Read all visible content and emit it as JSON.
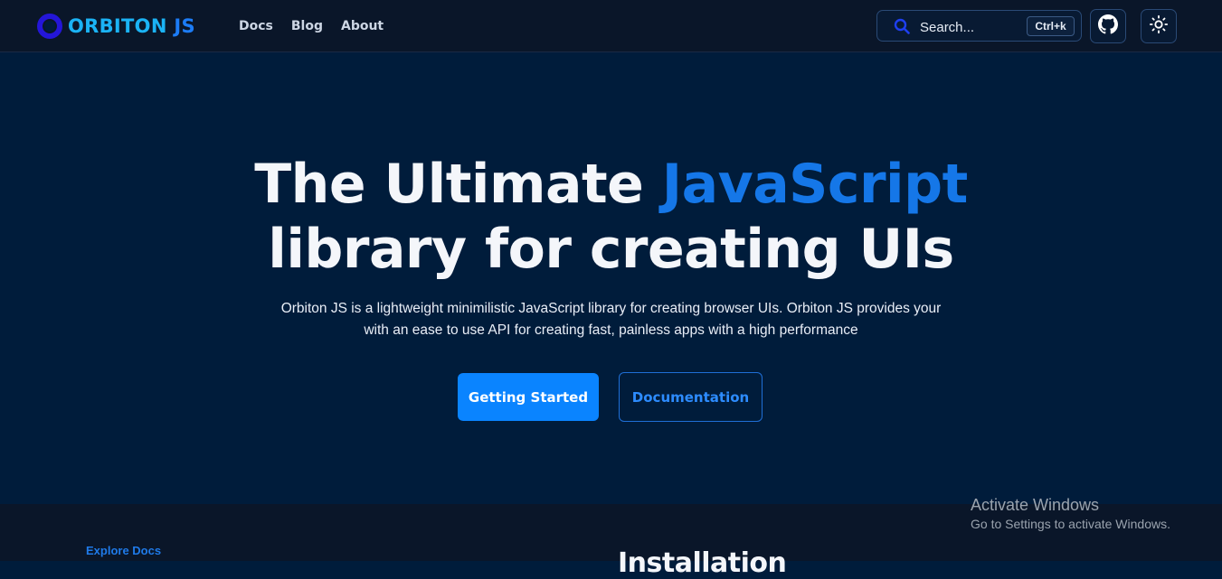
{
  "brand": {
    "name_main": "ORBITON",
    "name_suffix": "JS",
    "logo_icon": "orbit-ring-icon"
  },
  "nav": {
    "items": [
      {
        "label": "Docs"
      },
      {
        "label": "Blog"
      },
      {
        "label": "About"
      }
    ]
  },
  "search": {
    "placeholder": "Search...",
    "shortcut": "Ctrl+k",
    "icon": "search-icon"
  },
  "toolbar": {
    "github_icon": "github-icon",
    "theme_icon": "sun-icon"
  },
  "hero": {
    "title_part1": "The Ultimate ",
    "title_accent": "JavaScript",
    "title_part2": "library for creating UIs",
    "subtitle_line1": "Orbiton JS is a lightweight minimilistic JavaScript library for creating browser UIs. Orbiton JS provides your",
    "subtitle_line2": "with an ease to use API for creating fast, painless apps with a high performance",
    "primary_button": "Getting Started",
    "secondary_button": "Documentation"
  },
  "lower": {
    "explore_label": "Explore Docs",
    "section_heading": "Installation"
  },
  "watermark": {
    "line1": "Activate Windows",
    "line2": "Go to Settings to activate Windows."
  },
  "colors": {
    "background": "#001c3b",
    "topbar": "#0a1629",
    "accent": "#1577e8",
    "primary_button": "#0a84ff"
  }
}
